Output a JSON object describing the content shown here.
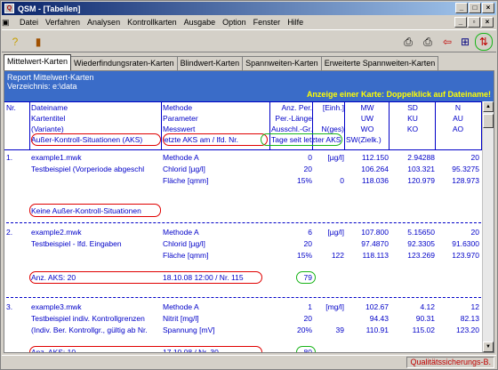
{
  "window": {
    "title": "QSM - [Tabellen]"
  },
  "menu": [
    "Datei",
    "Verfahren",
    "Analysen",
    "Kontrollkarten",
    "Ausgabe",
    "Option",
    "Fenster",
    "Hilfe"
  ],
  "tabs": [
    "Mittelwert-Karten",
    "Wiederfindungsraten-Karten",
    "Blindwert-Karten",
    "Spannweiten-Karten",
    "Erweiterte Spannweiten-Karten"
  ],
  "report": {
    "title": "Report Mittelwert-Karten",
    "dir": "Verzeichnis: e:\\data",
    "note": "Anzeige einer Karte: Doppelklick auf Dateiname!"
  },
  "headers": {
    "r1": [
      "Nr.",
      "Dateiname",
      "Methode",
      "Anz. Per.",
      "[Einh.]",
      "MW",
      "SD",
      "N"
    ],
    "r2": [
      "",
      "Kartentitel",
      "Parameter",
      "Per.-Länge",
      "",
      "UW",
      "KU",
      "AU"
    ],
    "r3": [
      "",
      "(Variante)",
      "Messwert",
      "Ausschl.-Gr.",
      "N(ges)",
      "WO",
      "KO",
      "AO"
    ],
    "r4": [
      "",
      "Außer-Kontroll-Situationen (AKS)",
      "letzte AKS am  / lfd. Nr.",
      "Tage seit letzter AKS",
      "SW(Zielk.)"
    ]
  },
  "records": [
    {
      "nr": "1.",
      "rows": [
        [
          "example1.mwk",
          "Methode A",
          "0",
          "[µg/l]",
          "112.150",
          "2.94288",
          "20"
        ],
        [
          "Testbeispiel  (Vorperiode abgeschl",
          "Chlorid [µg/l]",
          "20",
          "",
          "106.264",
          "103.321",
          "95.3275"
        ],
        [
          "",
          "Fläche [qmm]",
          "15%",
          "0",
          "118.036",
          "120.979",
          "128.973"
        ]
      ],
      "aks": "Keine Außer-Kontroll-Situationen",
      "aks_date": "",
      "days": ""
    },
    {
      "nr": "2.",
      "rows": [
        [
          "example2.mwk",
          "Methode A",
          "6",
          "[µg/l]",
          "107.800",
          "5.15650",
          "20"
        ],
        [
          "Testbeispiel - lfd. Eingaben",
          "Chlorid [µg/l]",
          "20",
          "",
          "97.4870",
          "92.3305",
          "91.6300"
        ],
        [
          "",
          "Fläche [qmm]",
          "15%",
          "122",
          "118.113",
          "123.269",
          "123.970"
        ]
      ],
      "aks": "Anz. AKS: 20",
      "aks_date": "18.10.08  12:00 / Nr. 115",
      "days": "79"
    },
    {
      "nr": "3.",
      "rows": [
        [
          "example3.mwk",
          "Methode A",
          "1",
          "[mg/l]",
          "102.67",
          "4.12",
          "12"
        ],
        [
          "Testbeispiel indiv. Kontrollgrenzen",
          "Nitrit [mg/l]",
          "20",
          "",
          "94.43",
          "90.31",
          "82.13"
        ],
        [
          "(Indiv. Ber. Kontrollgr., gültig ab Nr.",
          "Spannung [mV]",
          "20%",
          "39",
          "110.91",
          "115.02",
          "123.20"
        ]
      ],
      "aks": "Anz. AKS: 10",
      "aks_date": "17.10.08 / Nr. 30",
      "days": "80"
    }
  ],
  "status": {
    "right": "Qualitätssicherungs-B."
  },
  "colors": {
    "accent": "#3a6cc8",
    "text_blue": "#0000c8",
    "highlight_red": "#e00000",
    "highlight_green": "#18b418"
  }
}
